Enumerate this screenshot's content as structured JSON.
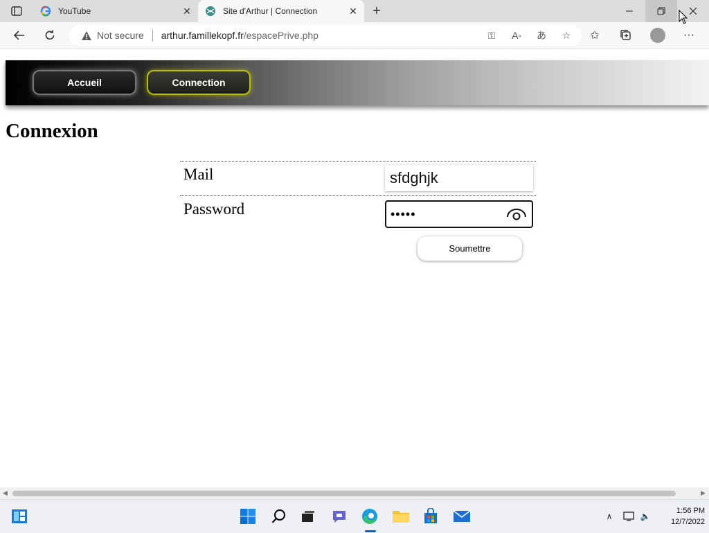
{
  "browser": {
    "tabs": [
      {
        "title": "YouTube",
        "active": false,
        "favicon": "google-g-icon"
      },
      {
        "title": "Site d'Arthur | Connection",
        "active": true,
        "favicon": "site-favicon-icon"
      }
    ],
    "security_label": "Not secure",
    "url_domain": "arthur.famillekopf.fr",
    "url_path": "/espacePrive.php"
  },
  "site": {
    "nav": {
      "home_label": "Accueil",
      "connection_label": "Connection"
    },
    "heading": "Connexion",
    "form": {
      "mail_label": "Mail",
      "mail_value": "sfdghjk",
      "password_label": "Password",
      "password_value": "•••••",
      "submit_label": "Soumettre"
    }
  },
  "taskbar": {
    "time": "1:56 PM",
    "date": "12/7/2022"
  },
  "colors": {
    "accent_blue": "#0067c0",
    "connection_glow": "#b8c000"
  }
}
